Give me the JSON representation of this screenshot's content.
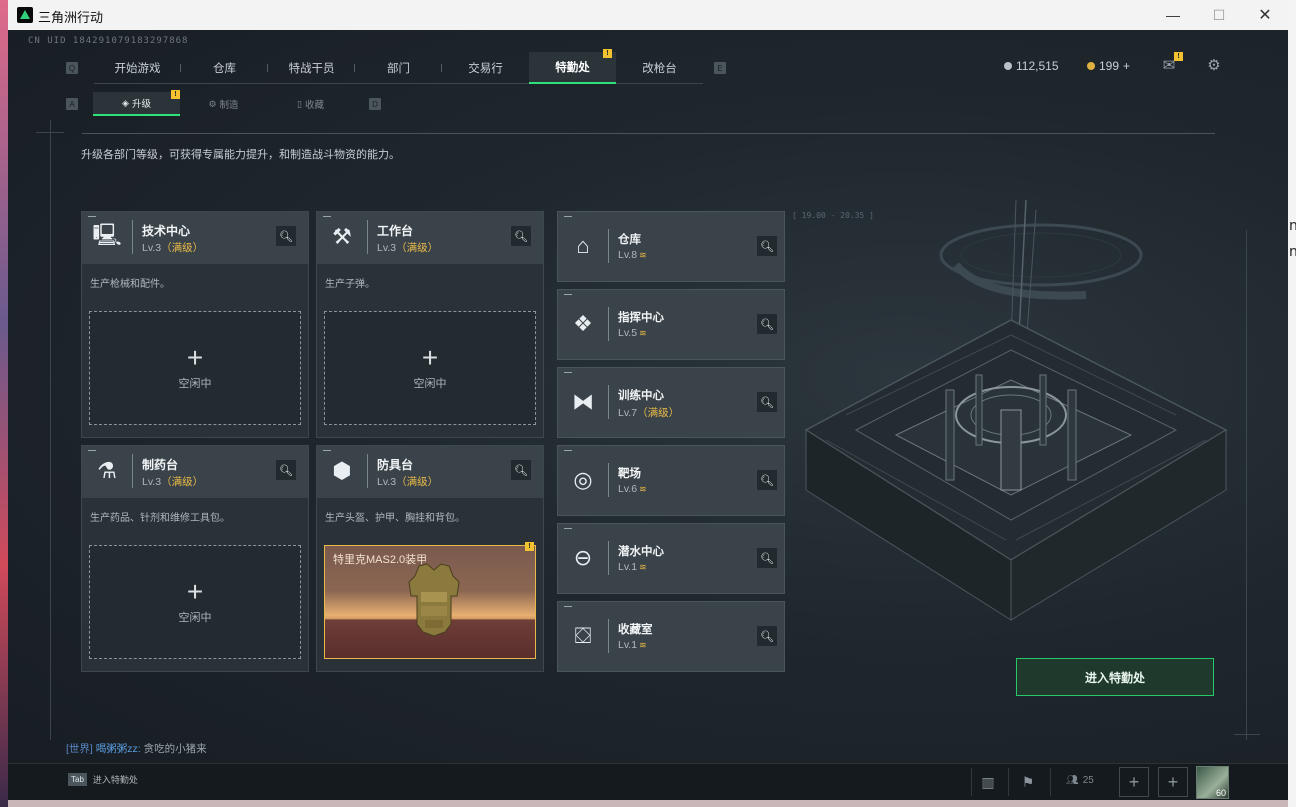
{
  "window": {
    "title": "三角洲行动",
    "controls": [
      "—",
      "☐",
      "✕"
    ]
  },
  "uid": "CN UID 184291079183297868",
  "topnav": {
    "q_key": "Q",
    "e_key": "E",
    "items": [
      {
        "label": "开始游戏"
      },
      {
        "label": "仓库"
      },
      {
        "label": "特战干员"
      },
      {
        "label": "部门"
      },
      {
        "label": "交易行"
      },
      {
        "label": "特勤处",
        "badge": "!"
      },
      {
        "label": "改枪台"
      }
    ]
  },
  "currency": {
    "coins": "112,515",
    "gold": "199",
    "gold_add": "+"
  },
  "subnav": {
    "a_key": "A",
    "d_key": "D",
    "items": [
      {
        "label": "升级",
        "badge": "!"
      },
      {
        "label": "制造"
      },
      {
        "label": "收藏"
      }
    ]
  },
  "description": "升级各部门等级，可获得专属能力提升，和制造战斗物资的能力。",
  "workstations": [
    {
      "name": "技术中心",
      "level": "Lv.3",
      "max": "（满级）",
      "desc": "生产枪械和配件。",
      "slot": "空闲中"
    },
    {
      "name": "工作台",
      "level": "Lv.3",
      "max": "（满级）",
      "desc": "生产子弹。",
      "slot": "空闲中"
    },
    {
      "name": "制药台",
      "level": "Lv.3",
      "max": "（满级）",
      "desc": "生产药品、针剂和维修工具包。",
      "slot": "空闲中"
    },
    {
      "name": "防具台",
      "level": "Lv.3",
      "max": "（满级）",
      "desc": "生产头盔、护甲、胸挂和背包。",
      "crafting": "特里克MAS2.0装甲",
      "crafting_badge": "!"
    }
  ],
  "facilities": [
    {
      "name": "仓库",
      "level": "Lv.8",
      "suffix": "≋"
    },
    {
      "name": "指挥中心",
      "level": "Lv.5",
      "suffix": "≋"
    },
    {
      "name": "训练中心",
      "level": "Lv.7",
      "suffix": "（满级）"
    },
    {
      "name": "靶场",
      "level": "Lv.6",
      "suffix": "≋"
    },
    {
      "name": "潜水中心",
      "level": "Lv.1",
      "suffix": "≋"
    },
    {
      "name": "收藏室",
      "level": "Lv.1",
      "suffix": "≋"
    }
  ],
  "art_label": "[ 19.00 - 20.35 ]",
  "enter_button": "进入特勤处",
  "chat": {
    "channel": "[世界]",
    "user": "喝粥粥zz:",
    "message": "贪吃的小猪来"
  },
  "bottom": {
    "tab_key": "Tab",
    "tab_label": "进入特勤处",
    "friends_count": "25",
    "avatar_level": "60"
  },
  "colors": {
    "accent": "#2ee27a",
    "max_level": "#e9b949",
    "badge": "#f2c230"
  }
}
